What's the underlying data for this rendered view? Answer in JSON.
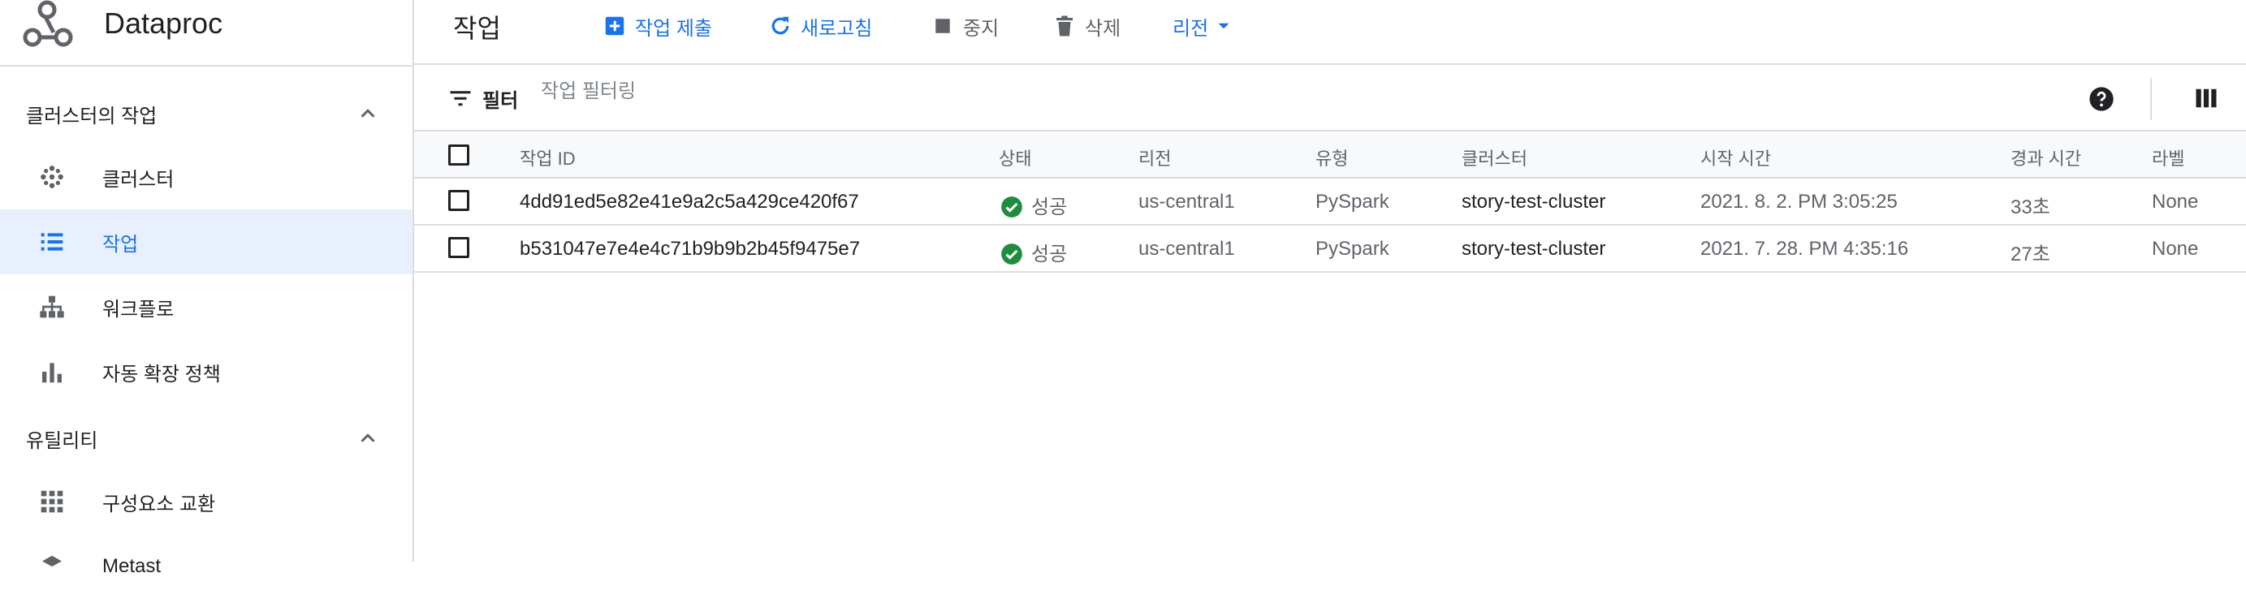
{
  "sidebar": {
    "brand": "Dataproc",
    "sections": [
      {
        "title": "클러스터의 작업",
        "items": [
          {
            "label": "클러스터",
            "icon": "cluster-icon"
          },
          {
            "label": "작업",
            "icon": "jobs-list-icon",
            "active": true
          },
          {
            "label": "워크플로",
            "icon": "workflow-icon"
          },
          {
            "label": "자동 확장 정책",
            "icon": "bar-chart-icon"
          }
        ]
      },
      {
        "title": "유틸리티",
        "items": [
          {
            "label": "구성요소 교환",
            "icon": "grid-apps-icon"
          },
          {
            "label": "Metast",
            "icon": "metastore-icon"
          }
        ]
      }
    ]
  },
  "toolbar": {
    "title": "작업",
    "submit_label": "작업 제출",
    "refresh_label": "새로고침",
    "stop_label": "중지",
    "delete_label": "삭제",
    "region_label": "리전"
  },
  "filter": {
    "label": "필터",
    "placeholder": "작업 필터링"
  },
  "table": {
    "headers": [
      "작업 ID",
      "상태",
      "리전",
      "유형",
      "클러스터",
      "시작 시간",
      "경과 시간",
      "라벨"
    ],
    "rows": [
      {
        "id": "4dd91ed5e82e41e9a2c5a429ce420f67",
        "status": "성공",
        "region": "us-central1",
        "type": "PySpark",
        "cluster": "story-test-cluster",
        "start": "2021. 8. 2. PM 3:05:25",
        "elapsed": "33초",
        "labels": "None"
      },
      {
        "id": "b531047e7e4e4c71b9b9b2b45f9475e7",
        "status": "성공",
        "region": "us-central1",
        "type": "PySpark",
        "cluster": "story-test-cluster",
        "start": "2021. 7. 28. PM 4:35:16",
        "elapsed": "27초",
        "labels": "None"
      }
    ]
  },
  "colors": {
    "accent": "#1a73e8",
    "success": "#1e8e3e",
    "active_bg": "#e8f0fe",
    "border": "#dadce0"
  }
}
